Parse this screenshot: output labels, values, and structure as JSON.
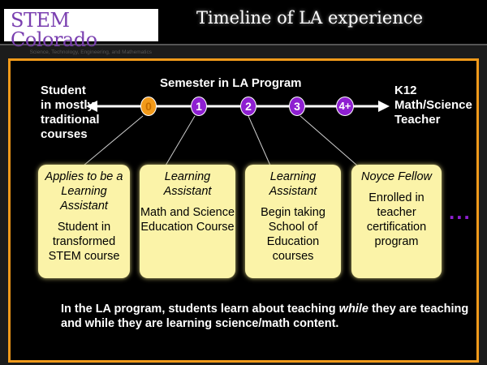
{
  "header": {
    "logo_title": "STEM Colorado",
    "logo_subtitle": "Science, Technology, Engineering, and Mathematics",
    "title": "Timeline of LA experience"
  },
  "timeline": {
    "axis_label": "Semester in LA Program",
    "left_label": "Student in mostly traditional courses",
    "right_label": "K12 Math/Science Teacher",
    "markers": [
      "0",
      "1",
      "2",
      "3",
      "4+"
    ]
  },
  "boxes": [
    {
      "role": "Applies to be a Learning Assistant",
      "desc": "Student in transformed STEM course"
    },
    {
      "role": "Learning Assistant",
      "desc": "Math and Science Education Course"
    },
    {
      "role": "Learning Assistant",
      "desc": "Begin taking School of Education courses"
    },
    {
      "role": "Noyce Fellow",
      "desc": "Enrolled in teacher certification program"
    }
  ],
  "continuation": "...",
  "note": {
    "pre": "In the LA program, students learn about teaching ",
    "em": "while",
    "post": " they are teaching and while they are learning science/math content."
  },
  "colors": {
    "frame": "#f29a1a",
    "marker": "#8e1fd1",
    "box": "#fbf3a8"
  }
}
